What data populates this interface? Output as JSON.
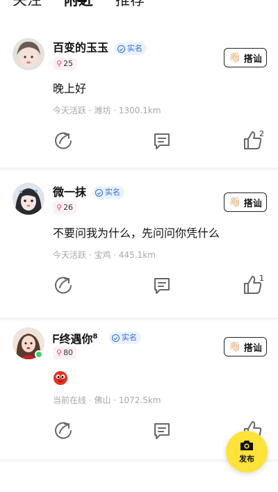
{
  "top_nav": {
    "tabs": [
      {
        "label": "关注"
      },
      {
        "label": "附近"
      },
      {
        "label": "推荐"
      }
    ],
    "active_tab": "附近"
  },
  "posts": [
    {
      "username": "百变的玉玉",
      "username_sup": "",
      "verify_label": "实名",
      "level": "25",
      "chat_label": "搭讪",
      "content": "晚上好",
      "meta": "今天活跃 · 潍坊 · 1300.1km",
      "like_count": "2",
      "online": false
    },
    {
      "username": "微一抹",
      "username_sup": "",
      "verify_label": "实名",
      "level": "26",
      "chat_label": "搭讪",
      "content": "不要问我为什么，先问问你凭什么",
      "meta": "今天活跃 · 宝鸡 · 445.1km",
      "like_count": "1",
      "online": false
    },
    {
      "username": "终遇你",
      "username_prefix": "ᖴ",
      "username_sup": "8",
      "verify_label": "实名",
      "level": "80",
      "chat_label": "搭讪",
      "content": "",
      "meta": "当前在线 · 佛山 · 1072.5km",
      "like_count": "",
      "online": true
    }
  ],
  "fab": {
    "label": "发布"
  },
  "colors": {
    "accent_yellow": "#ffe23a",
    "verify_blue": "#2f6bdc",
    "meta_gray": "#a7a7a7",
    "online_green": "#3fd06a"
  }
}
